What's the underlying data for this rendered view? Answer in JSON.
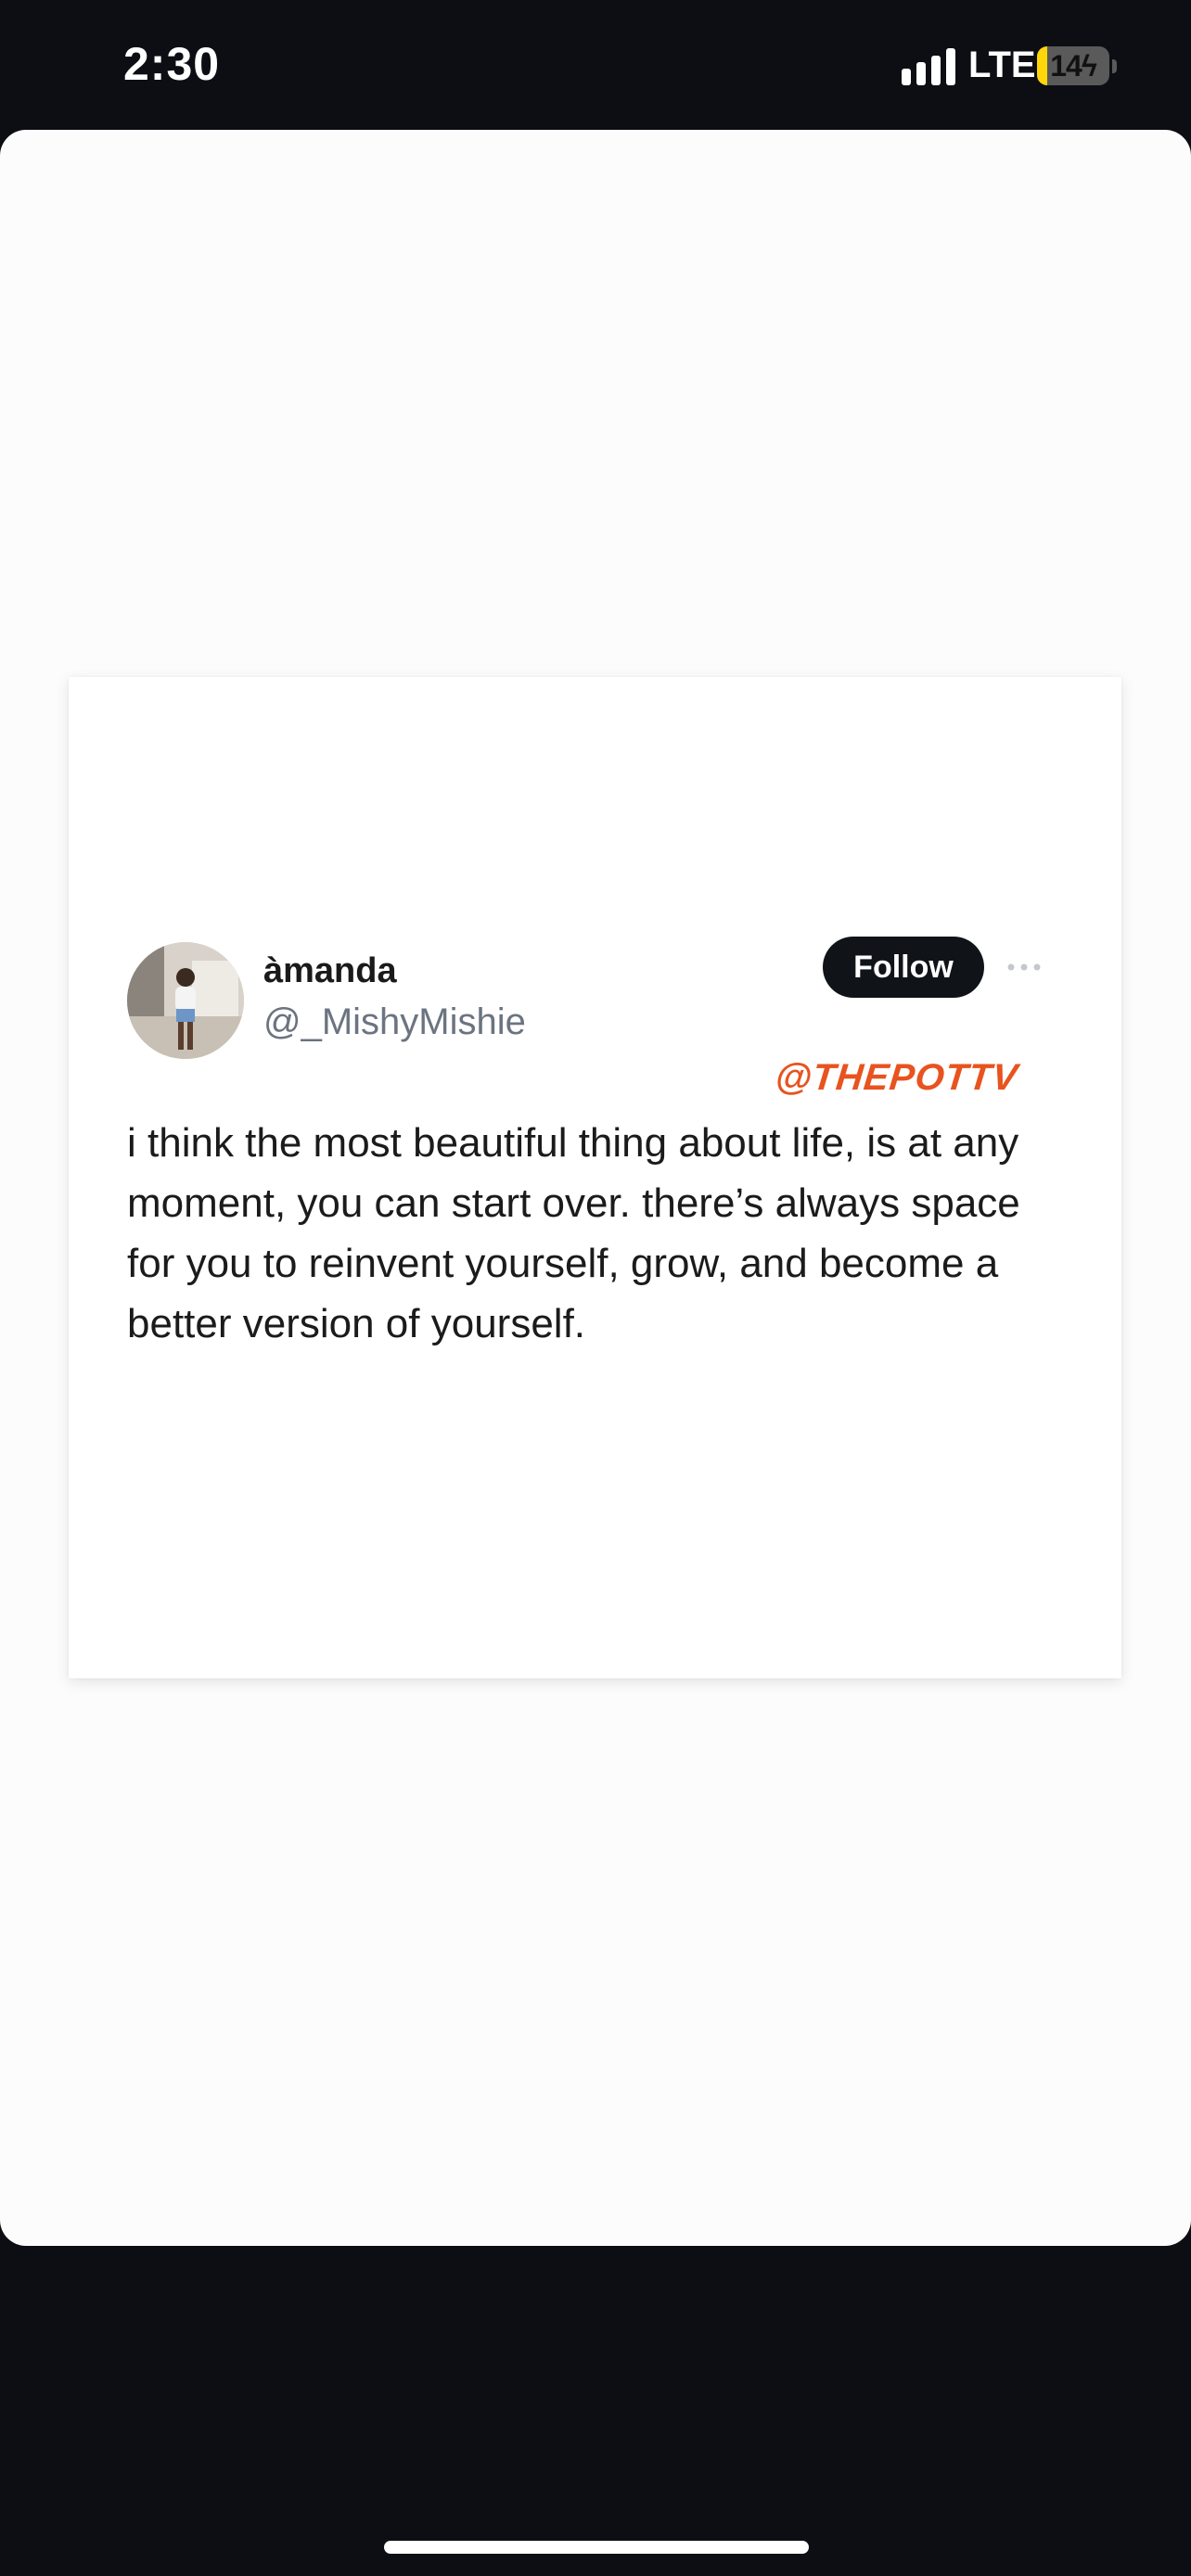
{
  "status_bar": {
    "time": "2:30",
    "network": "LTE",
    "battery_level": "14",
    "battery_charging": true,
    "icons": [
      "signal-icon",
      "battery-icon",
      "charging-bolt-icon"
    ]
  },
  "tweet": {
    "display_name": "àmanda",
    "handle": "@_MishyMishie",
    "follow_label": "Follow",
    "more_icon": "more-horizontal-icon",
    "text": "i think the most beautiful thing about life, is at any moment, you can start over. there’s always space for you to reinvent yourself, grow, and become a better version of yourself.",
    "avatar_icon": "profile-photo"
  },
  "watermark": "@THEPOTTV",
  "colors": {
    "background": "#0c0e13",
    "sheet": "#fcfcfc",
    "follow_button": "#101418",
    "watermark": "#e8531e",
    "battery_fill": "#ffd60a"
  }
}
